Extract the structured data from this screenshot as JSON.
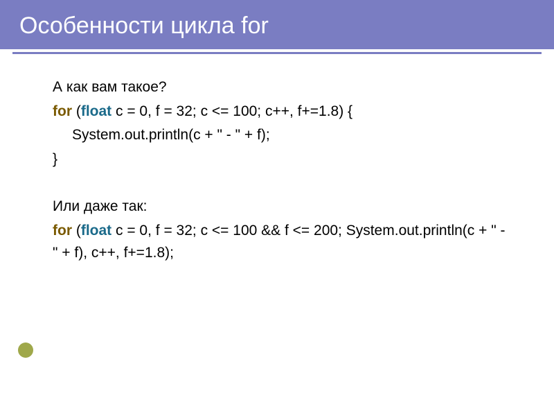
{
  "title": "Особенности цикла for",
  "lines": {
    "l1": "А как вам такое?",
    "l2a": "for",
    "l2b": " (",
    "l2c": "float",
    "l2d": " c = 0, f = 32; c <= 100; c++, f+=1.8) {",
    "l3": "System.out.println(c + \" - \" + f);",
    "l4": "}",
    "l5": "Или даже так:",
    "l6a": "for",
    "l6b": " (",
    "l6c": "float",
    "l6d": " c = 0, f = 32; c <= 100 && f <= 200; System.out.println(c + \" - \" + f), c++, f+=1.8);"
  }
}
